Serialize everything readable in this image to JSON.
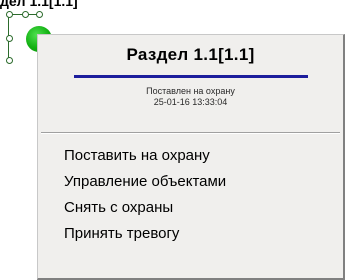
{
  "canvas": {
    "label": "дел 1.1[1.1]"
  },
  "menu": {
    "title": "Раздел 1.1[1.1]",
    "status_line1": "Поставлен на охрану",
    "status_line2": "25-01-16 13:33:04",
    "items": [
      {
        "label": "Поставить на охрану"
      },
      {
        "label": "Управление объектами"
      },
      {
        "label": "Снять с охраны"
      },
      {
        "label": "Принять тревогу"
      }
    ]
  },
  "colors": {
    "object_state": "#12b012",
    "selection": "#2c6b2c",
    "title_underline": "#1c1d9c",
    "menu_background": "#f0efed"
  }
}
